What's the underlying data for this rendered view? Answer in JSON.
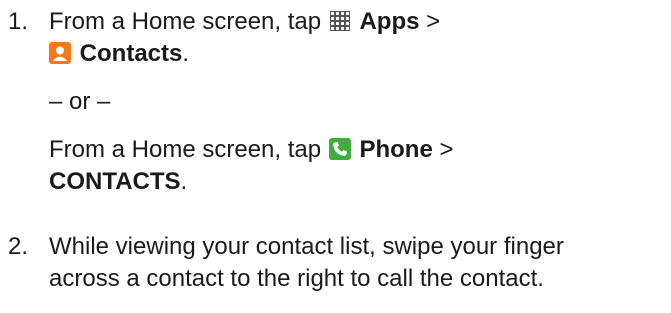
{
  "steps": [
    {
      "number": "1.",
      "line1": {
        "prefix": "From a Home screen, tap",
        "icon": "apps-grid-icon",
        "bold": "Apps",
        "suffix": ">"
      },
      "line2": {
        "icon": "contacts-icon",
        "bold": "Contacts",
        "suffix": "."
      },
      "or": "– or –",
      "alt_line1": {
        "prefix": "From a Home screen, tap",
        "icon": "phone-icon",
        "bold": "Phone",
        "suffix": ">"
      },
      "alt_line2": {
        "bold": "CONTACTS",
        "suffix": "."
      }
    },
    {
      "number": "2.",
      "line1": "While viewing your contact list, swipe your finger",
      "line2": "across a contact to the right to call the contact."
    }
  ],
  "colors": {
    "text": "#1a1a1a",
    "contacts_icon": "#f07a1c",
    "phone_icon_bg": "#3fae3a",
    "apps_icon": "#555555"
  }
}
